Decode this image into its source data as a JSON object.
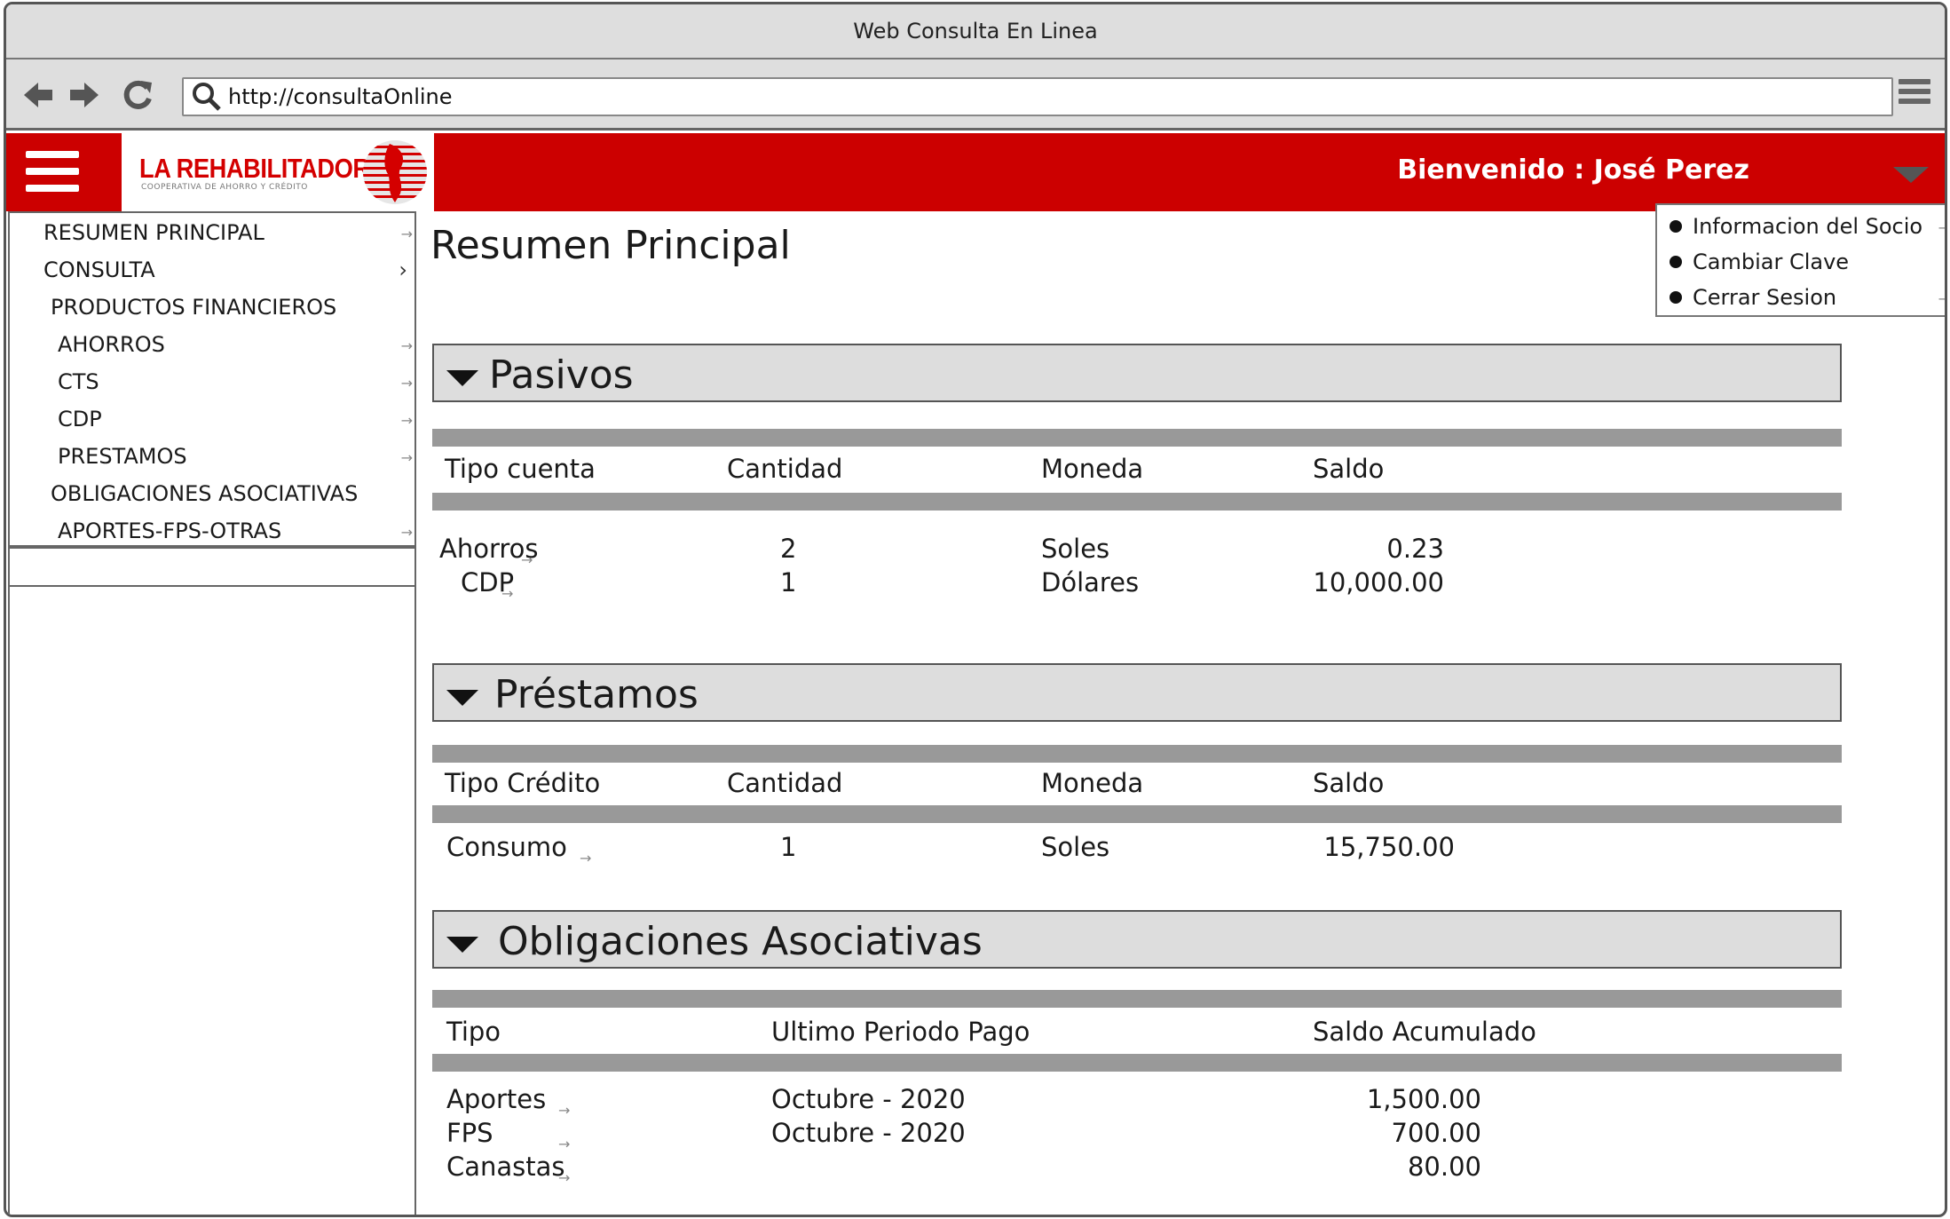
{
  "browser": {
    "window_title": "Web Consulta En Linea",
    "url": "http://consultaOnline"
  },
  "header": {
    "logo_title": "LA REHABILITADORA",
    "logo_subtitle": "COOPERATIVA DE AHORRO Y CRÉDITO",
    "welcome": "Bienvenido : José Perez",
    "brand_color": "#cc0000"
  },
  "user_menu": {
    "items": [
      {
        "label": "Informacion del Socio"
      },
      {
        "label": "Cambiar Clave"
      },
      {
        "label": "Cerrar Sesion"
      }
    ]
  },
  "sidebar": {
    "items": [
      {
        "label": "RESUMEN PRINCIPAL"
      },
      {
        "label": "CONSULTA"
      },
      {
        "label": "PRODUCTOS FINANCIEROS"
      },
      {
        "label": "AHORROS"
      },
      {
        "label": "CTS"
      },
      {
        "label": "CDP"
      },
      {
        "label": "PRESTAMOS"
      },
      {
        "label": "OBLIGACIONES ASOCIATIVAS"
      },
      {
        "label": "APORTES-FPS-OTRAS"
      }
    ]
  },
  "main": {
    "page_title": "Resumen Principal",
    "pasivos": {
      "title": "Pasivos",
      "columns": [
        "Tipo cuenta",
        "Cantidad",
        "Moneda",
        "Saldo"
      ],
      "rows": [
        {
          "tipo": "Ahorros",
          "cantidad": "2",
          "moneda": "Soles",
          "saldo": "0.23"
        },
        {
          "tipo": "CDP",
          "cantidad": "1",
          "moneda": "Dólares",
          "saldo": "10,000.00"
        }
      ]
    },
    "prestamos": {
      "title": "Préstamos",
      "columns": [
        "Tipo Crédito",
        "Cantidad",
        "Moneda",
        "Saldo"
      ],
      "rows": [
        {
          "tipo": "Consumo",
          "cantidad": "1",
          "moneda": "Soles",
          "saldo": "15,750.00"
        }
      ]
    },
    "obligaciones": {
      "title": "Obligaciones Asociativas",
      "columns": [
        "Tipo",
        "Ultimo Periodo Pago",
        "Saldo Acumulado"
      ],
      "rows": [
        {
          "tipo": "Aportes",
          "periodo": "Octubre - 2020",
          "saldo": "1,500.00"
        },
        {
          "tipo": "FPS",
          "periodo": "Octubre - 2020",
          "saldo": "700.00"
        },
        {
          "tipo": "Canastas",
          "periodo": "",
          "saldo": "80.00"
        }
      ]
    }
  }
}
